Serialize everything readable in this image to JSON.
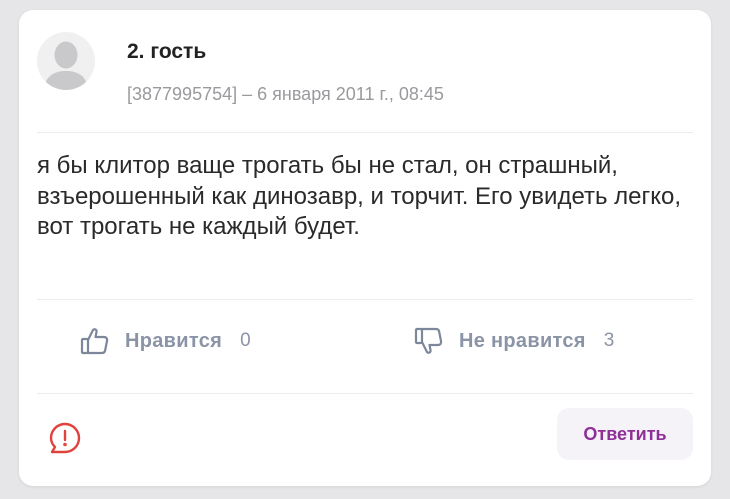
{
  "comment": {
    "author": "2. гость",
    "meta": "[3877995754] – 6 января 2011 г., 08:45",
    "text": "я бы клитор ваще трогать бы не стал, он страшный, взъерошенный как динозавр, и торчит. Его увидеть легко, вот трогать не каждый будет."
  },
  "reactions": {
    "like": {
      "label": "Нравится",
      "count": "0",
      "icon": "thumbs-up-icon"
    },
    "dislike": {
      "label": "Не нравится",
      "count": "3",
      "icon": "thumbs-down-icon"
    }
  },
  "actions": {
    "report_icon": "report-icon",
    "reply_label": "Ответить"
  },
  "colors": {
    "accent": "#8f2f9a",
    "reaction": "#8b94a6",
    "report": "#e0433b",
    "meta": "#9a9a9e"
  }
}
